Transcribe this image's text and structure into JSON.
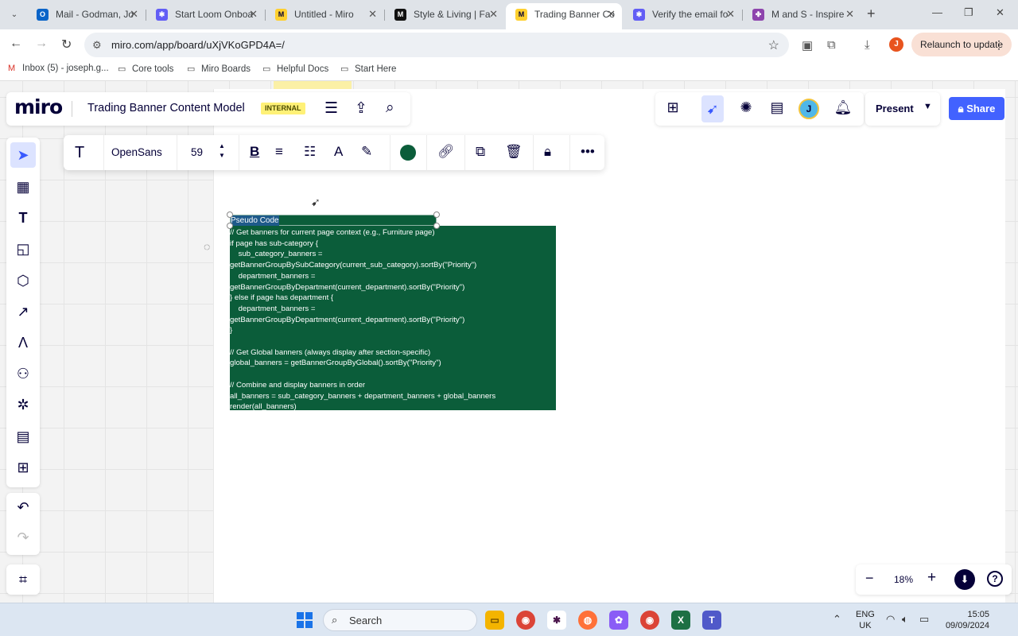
{
  "browser": {
    "tabs": [
      {
        "label": "Mail - Godman, Jo",
        "favicon": "outlook-icon",
        "color": "#0a64c8",
        "glyph": "O",
        "active": false
      },
      {
        "label": "Start Loom Onboa",
        "favicon": "loom-icon",
        "color": "#625df5",
        "glyph": "✱",
        "active": false
      },
      {
        "label": "Untitled - Miro",
        "favicon": "miro-icon",
        "color": "#ffd02f",
        "glyph": "M",
        "active": false
      },
      {
        "label": "Style & Living | Fa",
        "favicon": "ms-icon",
        "color": "#111111",
        "glyph": "M",
        "active": false
      },
      {
        "label": "Trading Banner Co",
        "favicon": "miro-icon",
        "color": "#ffd02f",
        "glyph": "M",
        "active": true
      },
      {
        "label": "Verify the email fo",
        "favicon": "loom-icon",
        "color": "#625df5",
        "glyph": "✱",
        "active": false
      },
      {
        "label": "M and S - Inspire",
        "favicon": "figma-icon",
        "color": "#8e44ad",
        "glyph": "✤",
        "active": false
      }
    ],
    "url": "miro.com/app/board/uXjVKoGPD4A=/",
    "relaunch_label": "Relaunch to update",
    "profile_initial": "J",
    "bookmarks": [
      {
        "label": "Inbox (5) - joseph.g...",
        "icon": "gmail-icon"
      },
      {
        "label": "Core tools",
        "icon": "folder-icon"
      },
      {
        "label": "Miro Boards",
        "icon": "folder-icon"
      },
      {
        "label": "Helpful Docs",
        "icon": "folder-icon"
      },
      {
        "label": "Start Here",
        "icon": "folder-icon"
      }
    ]
  },
  "miro": {
    "logo": "miro",
    "board_title": "Trading Banner Content Model",
    "badge": "INTERNAL",
    "avatar_initial": "J",
    "present_label": "Present",
    "share_label": "Share",
    "zoom_level": "18%",
    "context_toolbar": {
      "font_name": "OpenSans",
      "font_size": "59",
      "fill_color": "#0b5d3a"
    },
    "sticky": {
      "title": "Pseudo Code",
      "lines": [
        "// Get banners for current page context (e.g., Furniture page)",
        "if page has sub-category {",
        "    sub_category_banners =",
        "getBannerGroupBySubCategory(current_sub_category).sortBy(\"Priority\")",
        "    department_banners =",
        "getBannerGroupByDepartment(current_department).sortBy(\"Priority\")",
        "} else if page has department {",
        "    department_banners =",
        "getBannerGroupByDepartment(current_department).sortBy(\"Priority\")",
        "}",
        "",
        "// Get Global banners (always display after section-specific)",
        "global_banners = getBannerGroupByGlobal().sortBy(\"Priority\")",
        "",
        "// Combine and display banners in order",
        "all_banners = sub_category_banners + department_banners + global_banners",
        "render(all_banners)"
      ]
    }
  },
  "taskbar": {
    "search_label": "Search",
    "lang_top": "ENG",
    "lang_bottom": "UK",
    "time": "15:05",
    "date": "09/09/2024"
  }
}
